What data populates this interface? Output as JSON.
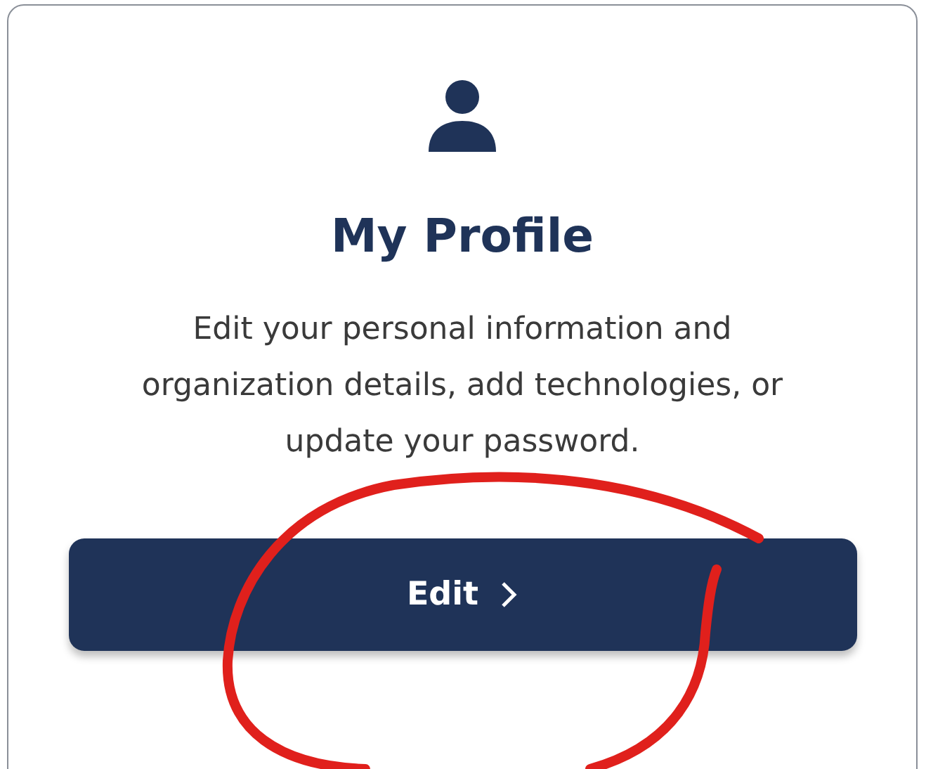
{
  "card": {
    "title": "My Profile",
    "description": "Edit your personal information and organization details, add technologies, or update your password.",
    "button": {
      "label": "Edit"
    }
  },
  "annotation": {
    "kind": "freehand-circle"
  }
}
